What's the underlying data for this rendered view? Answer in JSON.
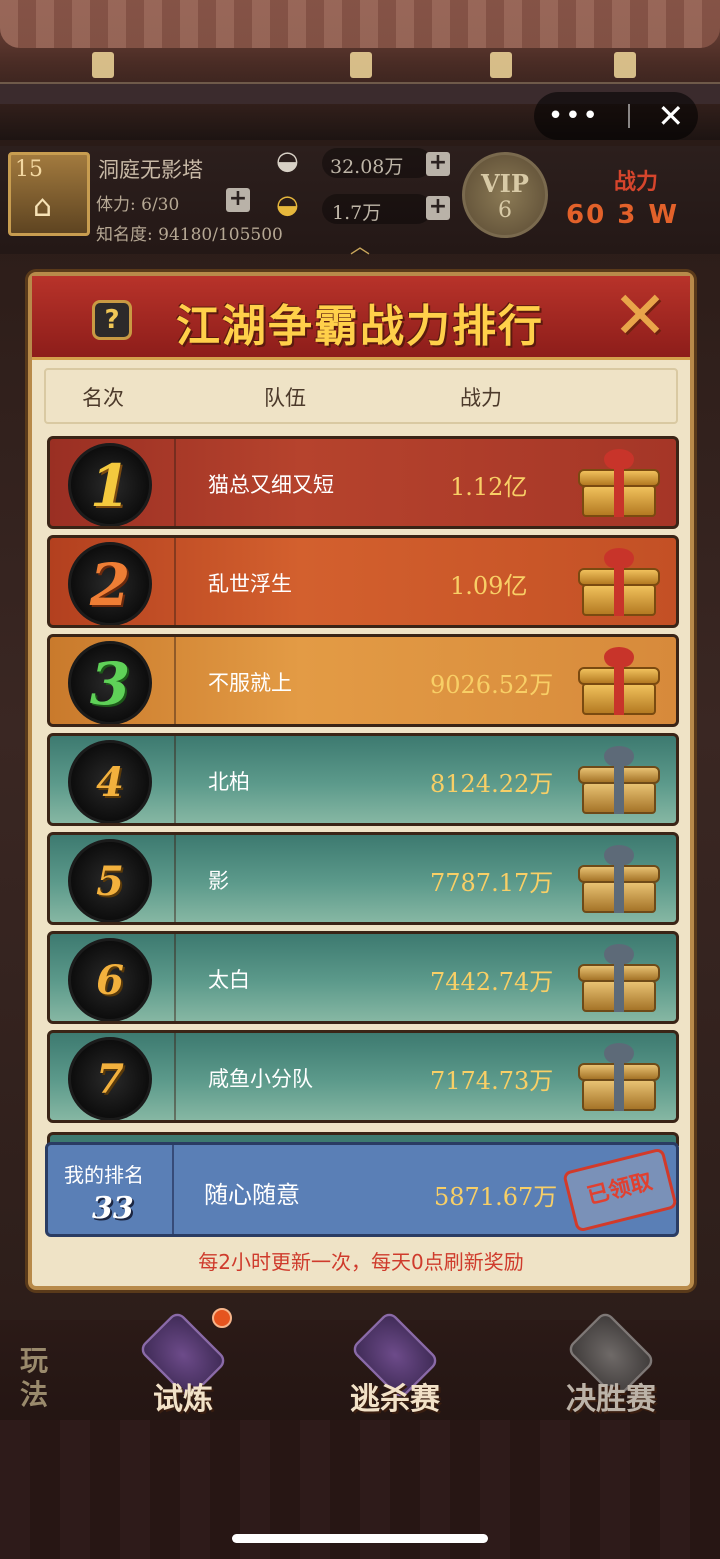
{
  "hud": {
    "level": "15",
    "location_name": "洞庭无影塔",
    "stamina": "体力: 6/30",
    "fame": "知名度: 94180/105500",
    "silver": "32.08万",
    "gold": "1.7万",
    "vip_label": "VIP",
    "vip_level": "6",
    "power_label": "战力",
    "power_value": "60 3 W"
  },
  "capsule": {
    "more": "•••",
    "close": "✕"
  },
  "panel": {
    "title": "江湖争霸战力排行",
    "help": "?",
    "close": "✕",
    "columns": [
      "名次",
      "队伍",
      "战力"
    ],
    "rows": [
      {
        "rank": "1",
        "team": "猫总又细又短",
        "power": "1.12亿",
        "tier": "top1"
      },
      {
        "rank": "2",
        "team": "乱世浮生",
        "power": "1.09亿",
        "tier": "top2"
      },
      {
        "rank": "3",
        "team": "不服就上",
        "power": "9026.52万",
        "tier": "top3"
      },
      {
        "rank": "4",
        "team": "北柏",
        "power": "8124.22万",
        "tier": "normal"
      },
      {
        "rank": "5",
        "team": "影",
        "power": "7787.17万",
        "tier": "normal"
      },
      {
        "rank": "6",
        "team": "太白",
        "power": "7442.74万",
        "tier": "normal"
      },
      {
        "rank": "7",
        "team": "咸鱼小分队",
        "power": "7174.73万",
        "tier": "normal"
      }
    ],
    "my_rank": {
      "label": "我的排名",
      "rank": "33",
      "team": "随心随意",
      "power": "5871.67万",
      "stamp": "已领取"
    },
    "footnote": "每2小时更新一次，每天0点刷新奖励"
  },
  "bottom_nav": {
    "play": "玩法",
    "items": [
      {
        "label": "试炼",
        "badge": true
      },
      {
        "label": "逃杀赛",
        "badge": false
      },
      {
        "label": "决胜赛",
        "badge": false
      }
    ]
  },
  "colors": {
    "title_gold": "#ffd04a",
    "panel_bg": "#efe3c6",
    "my_row_blue": "#5a7fb6",
    "footnote_red": "#cf3b2c"
  },
  "icons": [
    "house-icon",
    "silver-ingot-icon",
    "gold-ingot-icon",
    "plus-icon",
    "gift-chest-icon",
    "help-icon",
    "close-icon"
  ]
}
